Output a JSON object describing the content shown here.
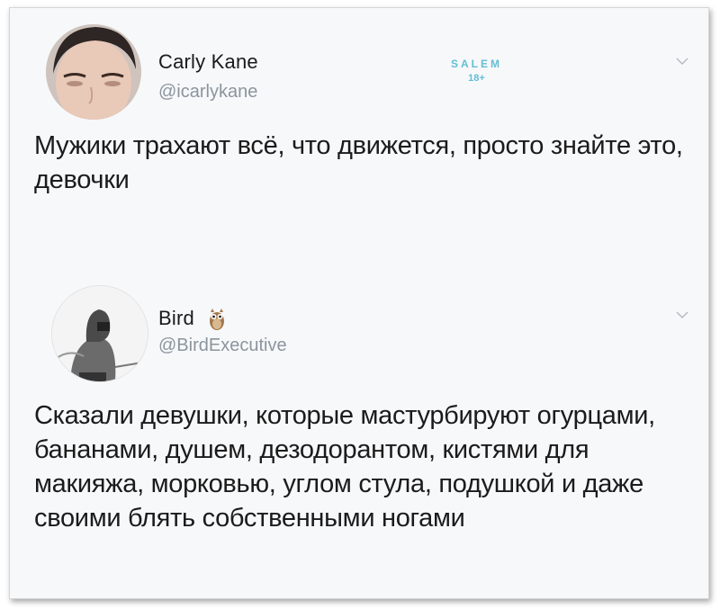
{
  "tweet1": {
    "name": "Carly Kane",
    "handle": "@icarlykane",
    "text": "Мужики трахают всё, что движется, просто знайте это, девочки"
  },
  "watermark": {
    "line1": "SALEM",
    "line2": "18+"
  },
  "tweet2": {
    "name": "Bird",
    "handle": "@BirdExecutive",
    "text": "Сказали девушки, которые мастурбируют огурцами, бананами, душем, дезодорантом, кистями для макияжа, морковью, углом стула, подушкой и даже своими блять собственными ногами"
  },
  "icons": {
    "chevron": "chevron-down-icon",
    "emoji": "owl-icon"
  },
  "colors": {
    "handle": "#8b959e",
    "watermark": "#62bfd4"
  }
}
